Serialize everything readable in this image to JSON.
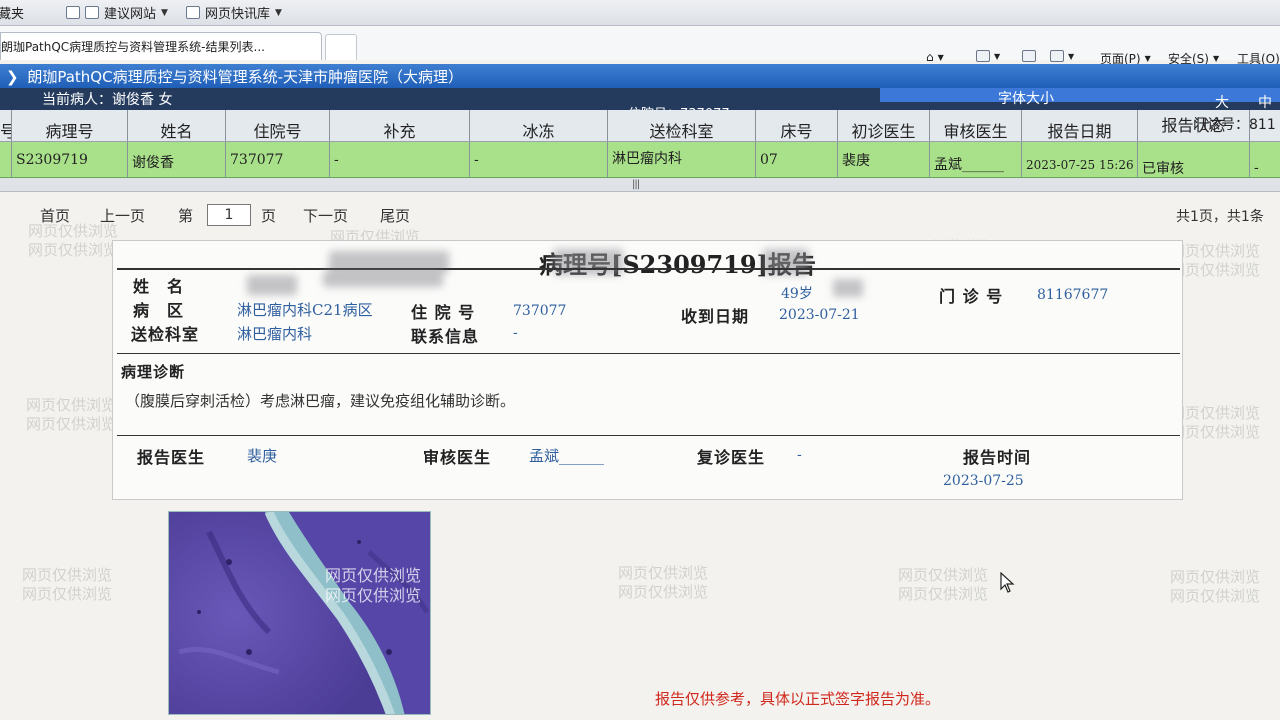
{
  "browser": {
    "favorites": [
      {
        "label": "藏夹",
        "icon": "star-icon"
      },
      {
        "label": "建议网站",
        "icon": "web-slice-icon"
      },
      {
        "label": "网页快讯库",
        "icon": "feed-icon"
      }
    ],
    "tab_title": "朗珈PathQC病理质控与资料管理系统-结果列表...",
    "commands": {
      "page": "页面(P)",
      "safety": "安全(S)",
      "tools": "工具(O)"
    }
  },
  "app": {
    "title": "朗珈PathQC病理质控与资料管理系统-天津市肿瘤医院（大病理）",
    "current_patient": "当前病人：谢俊香 女",
    "inpatient_no": "住院号：737077",
    "font_size_label": "字体大小",
    "font_large": "大",
    "font_medium": "中"
  },
  "grid": {
    "columns": [
      "号",
      "病理号",
      "姓名",
      "住院号",
      "补充",
      "冰冻",
      "送检科室",
      "床号",
      "初诊医生",
      "审核医生",
      "报告日期",
      "报告状态"
    ],
    "outpatient_label": "门诊号：811",
    "row": {
      "path_no": "S2309719",
      "name": "谢俊香",
      "inpatient_no": "737077",
      "supplement": "-",
      "frozen": "-",
      "dept": "淋巴瘤内科",
      "bed": "07",
      "first_doctor": "裴庚",
      "review_doctor": "孟斌______",
      "report_date": "2023-07-25 15:26",
      "status": "已审核",
      "extra": "-"
    }
  },
  "pager": {
    "first": "首页",
    "prev": "上一页",
    "page_prefix": "第",
    "page_no": "1",
    "page_suffix": "页",
    "next": "下一页",
    "last": "尾页",
    "total": "共1页，共1条"
  },
  "watermark_text": "网页仅供浏览",
  "report": {
    "title": "病理号[S2309719]报告",
    "labels": {
      "name": "姓　名",
      "ward": "病　区",
      "dept": "送检科室",
      "inpatient_no": "住 院 号",
      "contact": "联系信息",
      "received": "收到日期",
      "outpatient_no": "门 诊 号",
      "diagnosis": "病理诊断",
      "report_doctor": "报告医生",
      "review_doctor": "审核医生",
      "followup_doctor": "复诊医生",
      "report_time": "报告时间"
    },
    "values": {
      "ward": "淋巴瘤内科C21病区",
      "dept": "淋巴瘤内科",
      "inpatient_no": "737077",
      "contact": "-",
      "age": "49岁",
      "received": "2023-07-21",
      "outpatient_no": "81167677",
      "diagnosis": "（腹膜后穿刺活检）考虑淋巴瘤，建议免疫组化辅助诊断。",
      "report_doctor": "裴庚",
      "review_doctor": "孟斌______",
      "followup_doctor": "-",
      "report_time": "2023-07-25"
    }
  },
  "disclaimer": "报告仅供参考，具体以正式签字报告为准。"
}
